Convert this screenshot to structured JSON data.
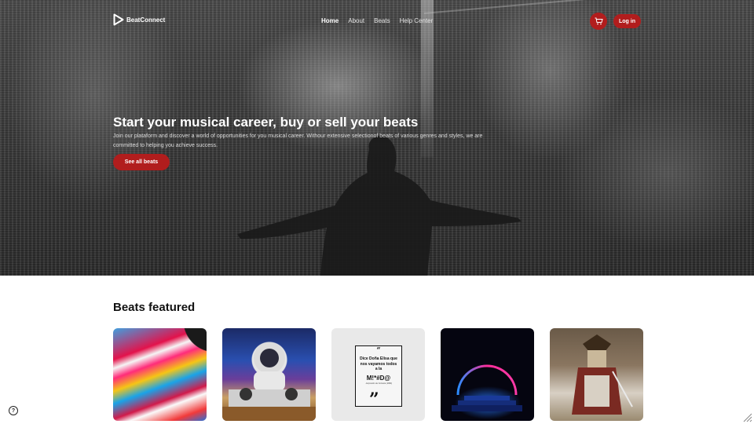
{
  "nav": {
    "brand": "BeatConnect",
    "links": [
      {
        "label": "Home",
        "active": true
      },
      {
        "label": "About",
        "active": false
      },
      {
        "label": "Beats",
        "active": false
      },
      {
        "label": "Help Center",
        "active": false
      }
    ],
    "cart_icon": "cart-icon",
    "login_label": "Log in"
  },
  "hero": {
    "title_start": "Start your musical career, ",
    "title_bold": "buy or sell your beats",
    "description": "Join our plataform and discover a world of opportunities for you musical career. Withour extensive selectionof beats of various genres and styles, we are committed to helping you achieve success.",
    "cta_label": "See all beats"
  },
  "featured": {
    "title_start": "Beats ",
    "title_bold": "featured",
    "cards": [
      {
        "art": "abstract-paint-pour"
      },
      {
        "art": "astronaut-dj"
      },
      {
        "art": "quote-poster",
        "quote_text": "Dice Doña Elisa que nos vayamos todos a la",
        "quote_big": "M!*#D@",
        "quote_small": "- Expresión de Cortesía (1982)"
      },
      {
        "art": "neon-arch"
      },
      {
        "art": "samurai-painting"
      }
    ]
  },
  "footer": {
    "help_icon": "help-circle-icon",
    "help_glyph": "?"
  },
  "colors": {
    "accent": "#b11d1d",
    "hero_text": "#ffffff",
    "page_bg": "#ffffff"
  }
}
